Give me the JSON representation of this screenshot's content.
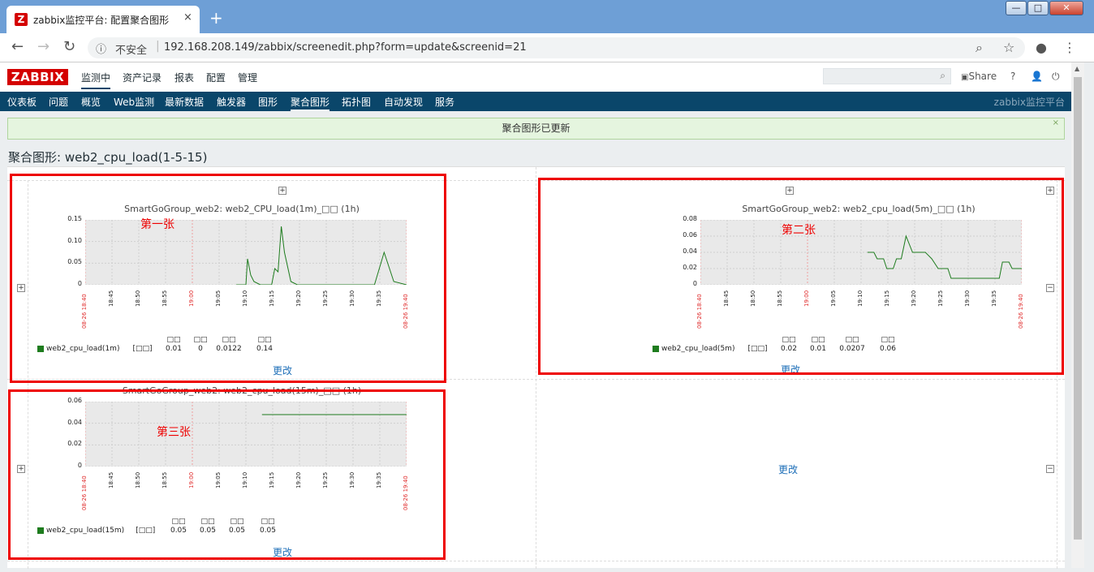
{
  "browser": {
    "tab_title": "zabbix监控平台: 配置聚合图形",
    "tab_close": "×",
    "new_tab": "+",
    "url_insecure": "不安全",
    "url": "192.168.208.149/zabbix/screenedit.php?form=update&screenid=21",
    "win_min": "—",
    "win_max": "□",
    "win_close": "✕"
  },
  "header": {
    "logo": "ZABBIX",
    "menu": [
      "监测中",
      "资产记录",
      "报表",
      "配置",
      "管理"
    ],
    "share": "Share",
    "help": "?"
  },
  "subnav": {
    "items": [
      "仪表板",
      "问题",
      "概览",
      "Web监测",
      "最新数据",
      "触发器",
      "图形",
      "聚合图形",
      "拓扑图",
      "自动发现",
      "服务"
    ],
    "active_index": 7,
    "site_name": "zabbix监控平台"
  },
  "message": {
    "text": "聚合图形已更新",
    "close": "×"
  },
  "page_title": "聚合图形: web2_cpu_load(1-5-15)",
  "graphs": [
    {
      "title": "SmartGoGroup_web2: web2_CPU_load(1m)_□□ (1h)",
      "yticks": [
        "0.15",
        "0.10",
        "0.05",
        "0"
      ],
      "legend": "web2_cpu_load(1m)",
      "legend_bracket": "[□□]",
      "stat_headers": [
        "□□",
        "□□",
        "□□",
        "□□"
      ],
      "stat_values": [
        "0.01",
        "0",
        "0.0122",
        "0.14"
      ],
      "edit": "更改",
      "annotation": "第一张"
    },
    {
      "title": "SmartGoGroup_web2: web2_cpu_load(5m)_□□ (1h)",
      "yticks": [
        "0.08",
        "0.06",
        "0.04",
        "0.02",
        "0"
      ],
      "legend": "web2_cpu_load(5m)",
      "legend_bracket": "[□□]",
      "stat_headers": [
        "□□",
        "□□",
        "□□",
        "□□"
      ],
      "stat_values": [
        "0.02",
        "0.01",
        "0.0207",
        "0.06"
      ],
      "edit": "更改",
      "annotation": "第二张"
    },
    {
      "title": "SmartGoGroup_web2: web2_cpu_load(15m)_□□ (1h)",
      "yticks": [
        "0.06",
        "0.04",
        "0.02",
        "0"
      ],
      "legend": "web2_cpu_load(15m)",
      "legend_bracket": "[□□]",
      "stat_headers": [
        "□□",
        "□□",
        "□□",
        "□□"
      ],
      "stat_values": [
        "0.05",
        "0.05",
        "0.05",
        "0.05"
      ],
      "edit": "更改",
      "annotation": "第三张"
    }
  ],
  "xticks": [
    "08-26 18:40",
    "18:45",
    "18:50",
    "18:55",
    "19:00",
    "19:05",
    "19:10",
    "19:15",
    "19:20",
    "19:25",
    "19:30",
    "19:35",
    "08-26 19:40"
  ],
  "xticks_red_index": [
    0,
    4,
    12
  ],
  "empty_cell_edit": "更改",
  "colors": {
    "header_dark": "#0a466a",
    "logo_red": "#d40000",
    "series_green": "#1e7c1e",
    "annotation_red": "#ee0000"
  }
}
